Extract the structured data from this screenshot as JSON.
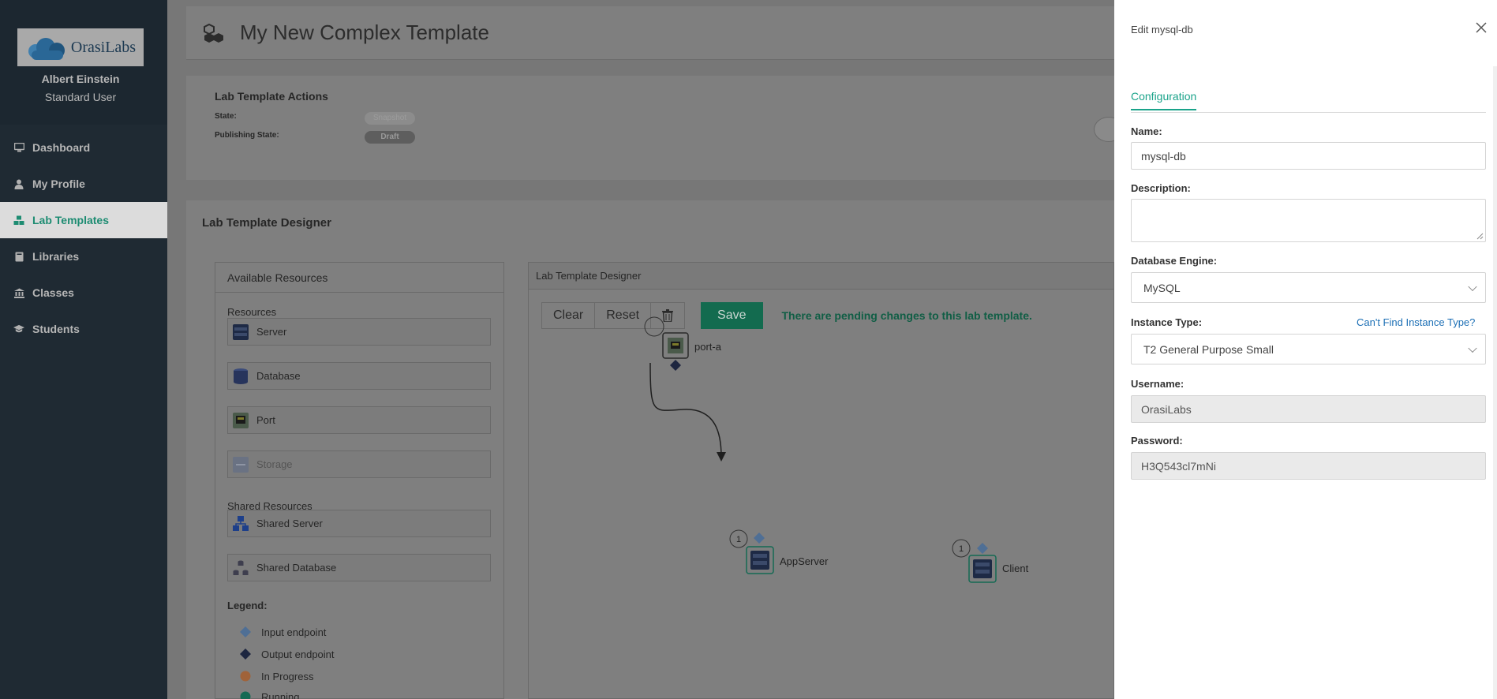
{
  "sidebar": {
    "logo_text": "OrasiLabs",
    "user_name": "Albert Einstein",
    "user_role": "Standard User",
    "nav": [
      {
        "label": "Dashboard",
        "icon": "monitor-icon",
        "active": false
      },
      {
        "label": "My Profile",
        "icon": "user-icon",
        "active": false
      },
      {
        "label": "Lab Templates",
        "icon": "cubes-icon",
        "active": true
      },
      {
        "label": "Libraries",
        "icon": "book-icon",
        "active": false
      },
      {
        "label": "Classes",
        "icon": "institution-icon",
        "active": false
      },
      {
        "label": "Students",
        "icon": "graduation-cap-icon",
        "active": false
      }
    ]
  },
  "header": {
    "title": "My New Complex Template"
  },
  "actions": {
    "title": "Lab Template Actions",
    "state_label": "State:",
    "state_value": "Snapshot",
    "publishing_label": "Publishing State:",
    "publishing_value": "Draft"
  },
  "designer": {
    "title": "Lab Template Designer",
    "resources_panel_title": "Available Resources",
    "resources_section": "Resources",
    "resources": [
      "Server",
      "Database",
      "Port",
      "Storage"
    ],
    "shared_section": "Shared Resources",
    "shared_resources": [
      "Shared Server",
      "Shared Database"
    ],
    "legend_title": "Legend:",
    "legend": [
      {
        "label": "Input endpoint",
        "color": "#4f6f95"
      },
      {
        "label": "Output endpoint",
        "color": "#1d2640"
      },
      {
        "label": "In Progress",
        "color": "#a0633a"
      },
      {
        "label": "Running",
        "color": "#156a54"
      }
    ],
    "canvas_title": "Lab Template Designer",
    "buttons": {
      "clear": "Clear",
      "reset": "Reset",
      "save": "Save"
    },
    "pending_message": "There are pending changes to this lab template.",
    "nodes": [
      {
        "label": "port-a"
      },
      {
        "label": "AppServer",
        "badge": "1"
      },
      {
        "label": "Client",
        "badge": "1"
      }
    ]
  },
  "edit_panel": {
    "title": "Edit mysql-db",
    "tab": "Configuration",
    "name_label": "Name:",
    "name_value": "mysql-db",
    "description_label": "Description:",
    "description_value": "",
    "engine_label": "Database Engine:",
    "engine_value": "MySQL",
    "instance_label": "Instance Type:",
    "instance_link": "Can't Find Instance Type?",
    "instance_value": "T2 General Purpose Small",
    "username_label": "Username:",
    "username_value": "OrasiLabs",
    "password_label": "Password:",
    "password_value": "H3Q543cl7mNi"
  },
  "colors": {
    "accent": "#1aa38a",
    "link": "#1c6fb5",
    "sidebar_bg": "#1f2a33",
    "save_button": "#136b4f"
  }
}
